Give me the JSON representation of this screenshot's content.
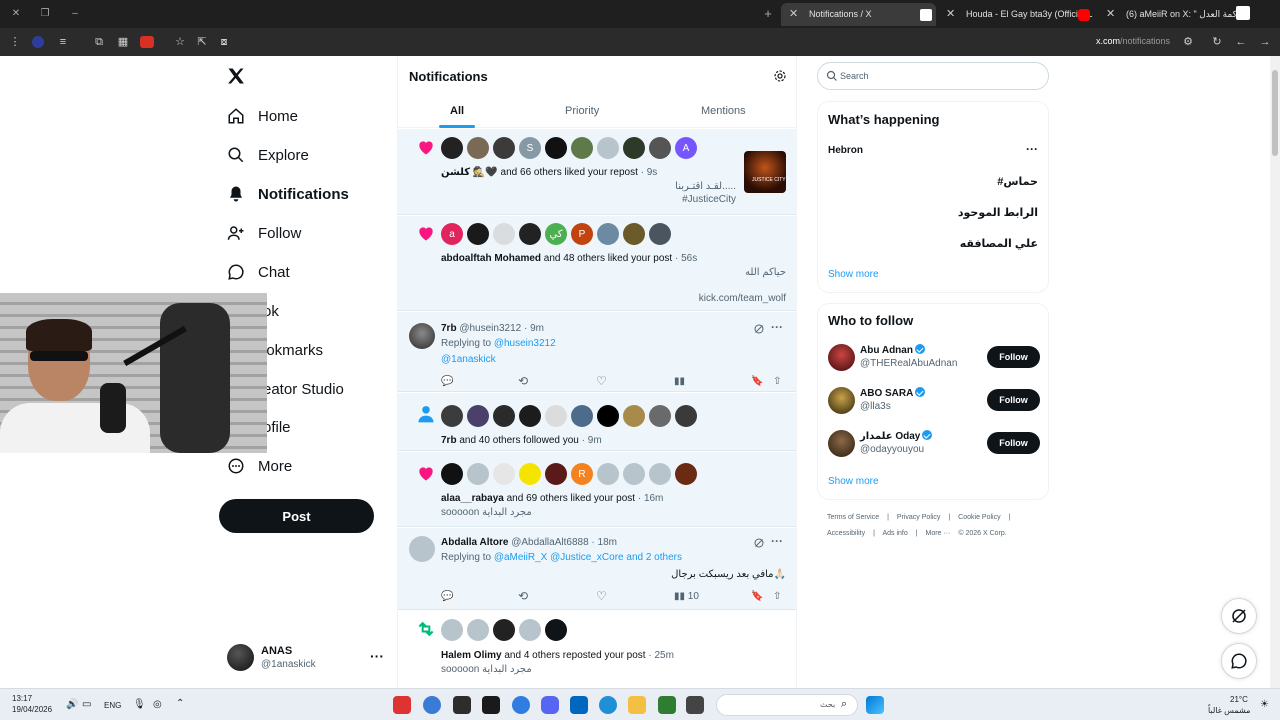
{
  "browser": {
    "tabs": [
      {
        "title": "Notifications / X",
        "active": true
      },
      {
        "title": "Houda - El Gay bta3y (Official L",
        "active": false
      },
      {
        "title": "(6) aMeiiR on X: \" كمة العدل",
        "active": false
      }
    ],
    "url_host": "x.com",
    "url_path": "/notifications"
  },
  "nav": {
    "items": [
      {
        "label": "Home",
        "icon": "home-icon"
      },
      {
        "label": "Explore",
        "icon": "search-icon"
      },
      {
        "label": "Notifications",
        "icon": "bell-icon",
        "active": true
      },
      {
        "label": "Follow",
        "icon": "person-add-icon"
      },
      {
        "label": "Chat",
        "icon": "chat-icon"
      },
      {
        "label": "rok",
        "icon": "grok-icon"
      },
      {
        "label": "ookmarks",
        "icon": "bookmark-icon"
      },
      {
        "label": "reator Studio",
        "icon": "studio-icon"
      },
      {
        "label": "rofile",
        "icon": "profile-icon"
      },
      {
        "label": "More",
        "icon": "more-circle-icon"
      }
    ],
    "post_label": "Post",
    "account": {
      "name": "ANAS",
      "handle": "@1anaskick"
    }
  },
  "main": {
    "title": "Notifications",
    "tabs": [
      "All",
      "Priority",
      "Mentions"
    ],
    "notifications": [
      {
        "type": "like",
        "avatars": [
          "",
          "",
          "",
          "S",
          "",
          "",
          "",
          "",
          "",
          "A"
        ],
        "actor": "كلشن 🕵🖤",
        "text": " and 66 others liked your repost",
        "time": "9s",
        "post_lines": [
          "لقـد اقتـربنا.....",
          "#JusticeCity"
        ],
        "thumb_text": "JUSTICE CITY"
      },
      {
        "type": "like",
        "avatars": [
          "a",
          "",
          "",
          "",
          "كي",
          "P",
          "",
          "",
          ""
        ],
        "actor": "abdoalftah Mohamed",
        "text": " and 48 others liked your post",
        "time": "56s",
        "post_lines": [
          "حياكم الله",
          "kick.com/team_wolf"
        ]
      },
      {
        "type": "reply",
        "name": "7rb",
        "handle": "@husein3212",
        "time": "9m",
        "replying_label": "Replying to",
        "replying_to": "@husein3212",
        "body": "@1anaskick",
        "views": ""
      },
      {
        "type": "follow",
        "avatars": [
          "",
          "",
          "",
          "",
          "",
          "",
          "",
          "",
          "",
          ""
        ],
        "actor": "7rb",
        "text": " and 40 others followed you",
        "time": "9m"
      },
      {
        "type": "like",
        "avatars": [
          "",
          "",
          "",
          "",
          "",
          "R",
          "",
          "",
          "",
          ""
        ],
        "actor": "alaa__rabaya",
        "text": " and 69 others liked your post",
        "time": "16m",
        "post_lines": [
          "sooooon مجرد البداية"
        ]
      },
      {
        "type": "reply",
        "name": "Abdalla Altore",
        "handle": "@AbdallaAlt6888",
        "time": "18m",
        "replying_label": "Replying to",
        "replying_to": "@aMeiiR_X @Justice_xCore and 2 others",
        "body": "مافي بعد ريسبكت برجال🙏🏻",
        "views": "10"
      },
      {
        "type": "repost",
        "avatars": [
          "",
          "",
          "",
          "",
          ""
        ],
        "actor": "Halem Olimy",
        "text": " and 4 others reposted your post",
        "time": "25m",
        "post_lines": [
          "sooooon مجرد البداية"
        ]
      }
    ]
  },
  "sidebar": {
    "search_placeholder": "Search",
    "happening": {
      "title": "What’s happening",
      "location": "Hebron",
      "trends": [
        "#حماس",
        "الرابط الموحود",
        "علي المصافقه"
      ],
      "show_more": "Show more"
    },
    "who_to_follow": {
      "title": "Who to follow",
      "accounts": [
        {
          "name": "Abu Adnan",
          "handle": "@THERealAbuAdnan",
          "verified": true
        },
        {
          "name": "ABO SARA",
          "handle": "@lla3s",
          "verified": true
        },
        {
          "name": "علمدار Oday",
          "handle": "@odayyouyou",
          "verified": true
        }
      ],
      "follow_label": "Follow",
      "show_more": "Show more"
    },
    "footer_links": [
      "Terms of Service",
      "|",
      "Privacy Policy",
      "|",
      "Cookie Policy",
      "|"
    ],
    "footer_links2": [
      "Accessibility",
      "|",
      "Ads info",
      "|",
      "More ···",
      "© 2026 X Corp."
    ]
  },
  "taskbar": {
    "time": "13:17",
    "date": "19/04/2026",
    "lang": "ENG",
    "search_placeholder": "بحث",
    "weather_temp": "21°C",
    "weather_desc": "مشمس غالباً"
  },
  "colors": {
    "accent": "#1d9bf0",
    "like": "#f91880",
    "repost": "#00ba7c",
    "unread_bg": "#eef6fc"
  }
}
